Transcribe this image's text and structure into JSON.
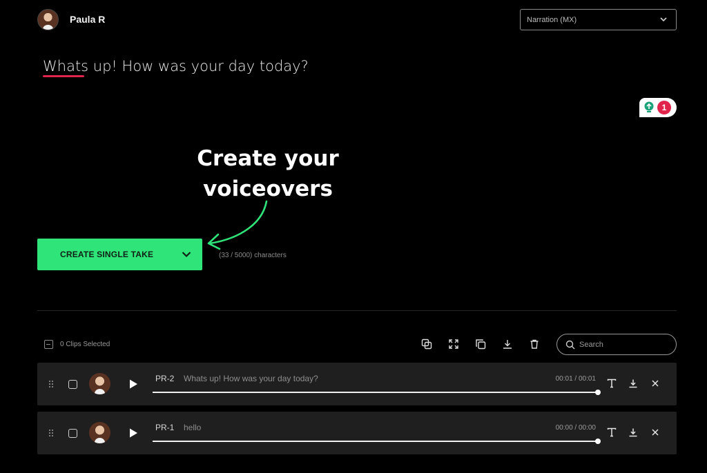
{
  "header": {
    "user_name": "Paula R",
    "voice_select_value": "Narration (MX)"
  },
  "editor": {
    "script_text": "Whats up! How was your day today?",
    "hint_count": "1"
  },
  "annotation": {
    "line1": "Create your",
    "line2": "voiceovers"
  },
  "actions": {
    "create_label": "CREATE SINGLE TAKE",
    "char_count": "(33 / 5000) characters"
  },
  "clips_toolbar": {
    "selected_label": "0 Clips Selected",
    "search_placeholder": "Search",
    "tools": [
      "merge-icon",
      "expand-icon",
      "duplicate-icon",
      "download-icon",
      "trash-icon"
    ]
  },
  "clips": [
    {
      "id": "PR-2",
      "text": "Whats up! How was your day today?",
      "time": "00:01 / 00:01",
      "progress": 1.0
    },
    {
      "id": "PR-1",
      "text": "hello",
      "time": "00:00 / 00:00",
      "progress": 1.0
    }
  ],
  "colors": {
    "accent_green": "#2fe57a",
    "accent_red": "#e0244b",
    "background": "#000000",
    "row_background": "#1f1f1f"
  }
}
